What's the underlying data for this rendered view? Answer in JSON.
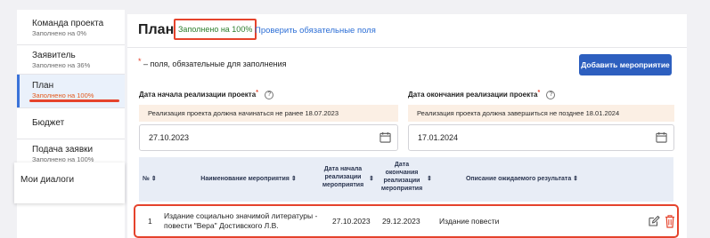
{
  "sidebar": {
    "items": [
      {
        "title": "Команда проекта",
        "status": "Заполнено на 0%"
      },
      {
        "title": "Заявитель",
        "status": "Заполнено на 36%"
      },
      {
        "title": "План",
        "status": "Заполнено на 100%"
      },
      {
        "title": "Бюджет",
        "status": ""
      },
      {
        "title": "Подача заявки",
        "status": "Заполнено на 100%"
      }
    ],
    "dialogs_label": "Мои диалоги"
  },
  "header": {
    "title": "План",
    "fill_status": "Заполнено на 100%",
    "check_link": "Проверить обязательные поля"
  },
  "form": {
    "required_note": "– поля, обязательные для заполнения",
    "required_star": "*",
    "add_button": "Добавить мероприятие",
    "start": {
      "label": "Дата начала реализации проекта",
      "hint": "Реализация проекта должна начинаться не ранее 18.07.2023",
      "value": "27.10.2023"
    },
    "end": {
      "label": "Дата окончания реализации проекта",
      "hint": "Реализация проекта должна завершиться не позднее 18.01.2024",
      "value": "17.01.2024"
    },
    "help_glyph": "?"
  },
  "table": {
    "headers": {
      "num": "№ ⇕",
      "name": "Наименование мероприятия ⇕",
      "start": "Дата начала реализации мероприятия",
      "start_sort": "⇕",
      "end": "Дата окончания реализации мероприятия",
      "end_sort": "⇕",
      "result": "Описание ожидаемого результата ⇕"
    },
    "rows": [
      {
        "num": "1",
        "name": "Издание социально значимой литературы - повести \"Вера\" Достивского Л.В.",
        "start": "27.10.2023",
        "end": "29.12.2023",
        "result": "Издание повести"
      }
    ]
  },
  "colors": {
    "accent": "#2d5fbf",
    "highlight": "#e5432c",
    "success": "#2d7d2d",
    "link": "#2d6fd6"
  },
  "icons": [
    "help-icon",
    "calendar-icon",
    "edit-icon",
    "trash-icon"
  ]
}
